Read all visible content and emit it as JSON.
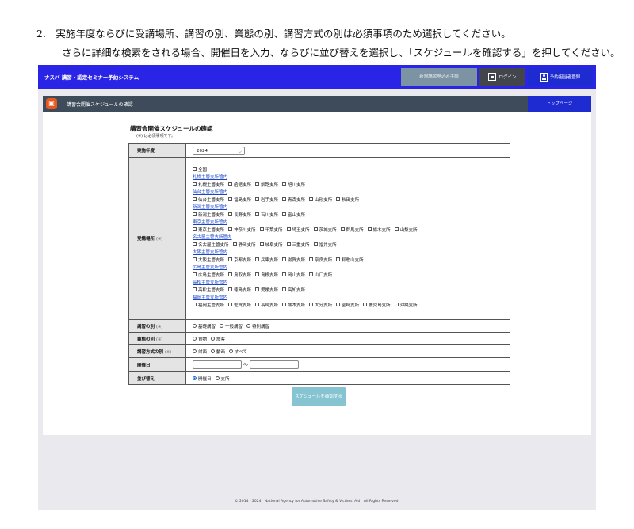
{
  "document": {
    "line1": "2.　実施年度ならびに受講場所、講習の別、業態の別、講習方式の別は必須事項のため選択してください。",
    "line2": "さらに詳細な検索をされる場合、開催日を入力、ならびに並び替えを選択し、「スケジュールを確認する」を押してください。"
  },
  "header": {
    "brand": "ナスバ 講習・認定セミナー予約システム",
    "topic_button": "新規講習申込み手続",
    "login_button": "ログイン",
    "register_button": "予約担当者登録"
  },
  "subheader": {
    "title": "講習会開催スケジュールの確認",
    "top_page_button": "トップページ"
  },
  "form": {
    "title": "講習会開催スケジュールの確認",
    "required_note": "(※) は必須事項です。",
    "required_mark": "(※)",
    "year": {
      "label": "実施年度",
      "value": "2024"
    },
    "location": {
      "label": "受講場所",
      "all": "全国",
      "regions": [
        {
          "name": "札幌主管支所管内",
          "items": [
            "札幌主管支所",
            "函館支所",
            "釧路支所",
            "旭川支所"
          ]
        },
        {
          "name": "仙台主管支所管内",
          "items": [
            "仙台主管支所",
            "福島支所",
            "岩手支所",
            "青森支所",
            "山形支所",
            "秋田支所"
          ]
        },
        {
          "name": "新潟主管支所管内",
          "items": [
            "新潟主管支所",
            "長野支所",
            "石川支所",
            "富山支所"
          ]
        },
        {
          "name": "東京主管支所管内",
          "items": [
            "東京主管支所",
            "神奈川支所",
            "千葉支所",
            "埼玉支所",
            "茨城支所",
            "群馬支所",
            "栃木支所",
            "山梨支所"
          ]
        },
        {
          "name": "名古屋主管支所管内",
          "items": [
            "名古屋主管支所",
            "静岡支所",
            "岐阜支所",
            "三重支所",
            "福井支所"
          ]
        },
        {
          "name": "大阪主管支所管内",
          "items": [
            "大阪主管支所",
            "京都支所",
            "兵庫支所",
            "滋賀支所",
            "奈良支所",
            "和歌山支所"
          ]
        },
        {
          "name": "広島主管支所管内",
          "items": [
            "広島主管支所",
            "鳥取支所",
            "島根支所",
            "岡山支所",
            "山口支所"
          ]
        },
        {
          "name": "高松主管支所管内",
          "items": [
            "高松主管支所",
            "徳島支所",
            "愛媛支所",
            "高知支所"
          ]
        },
        {
          "name": "福岡主管支所管内",
          "items": [
            "福岡主管支所",
            "佐賀支所",
            "長崎支所",
            "熊本支所",
            "大分支所",
            "宮崎支所",
            "鹿児島支所",
            "沖縄支所"
          ]
        }
      ]
    },
    "course_type": {
      "label": "講習の別",
      "options": [
        "基礎講習",
        "一般講習",
        "特別講習"
      ]
    },
    "business_type": {
      "label": "業態の別",
      "options": [
        "貨物",
        "旅客"
      ]
    },
    "course_method": {
      "label": "講習方式の別",
      "options": [
        "対面",
        "動画",
        "すべて"
      ]
    },
    "date": {
      "label": "開催日",
      "separator": "～"
    },
    "sort": {
      "label": "並び替え",
      "options": [
        "開催日",
        "支所"
      ],
      "selected": "開催日"
    },
    "submit": "スケジュールを確認する"
  },
  "footer": "© 2014 - 2024　National Agency for Automotive Safety & Victims' Aid　All Rights Reserved.",
  "colors": {
    "header": "#2a24e6",
    "accent": "#1e2bd0",
    "subheader": "#3d4b5a",
    "submit": "#86c4d2",
    "link": "#1a46c7"
  }
}
